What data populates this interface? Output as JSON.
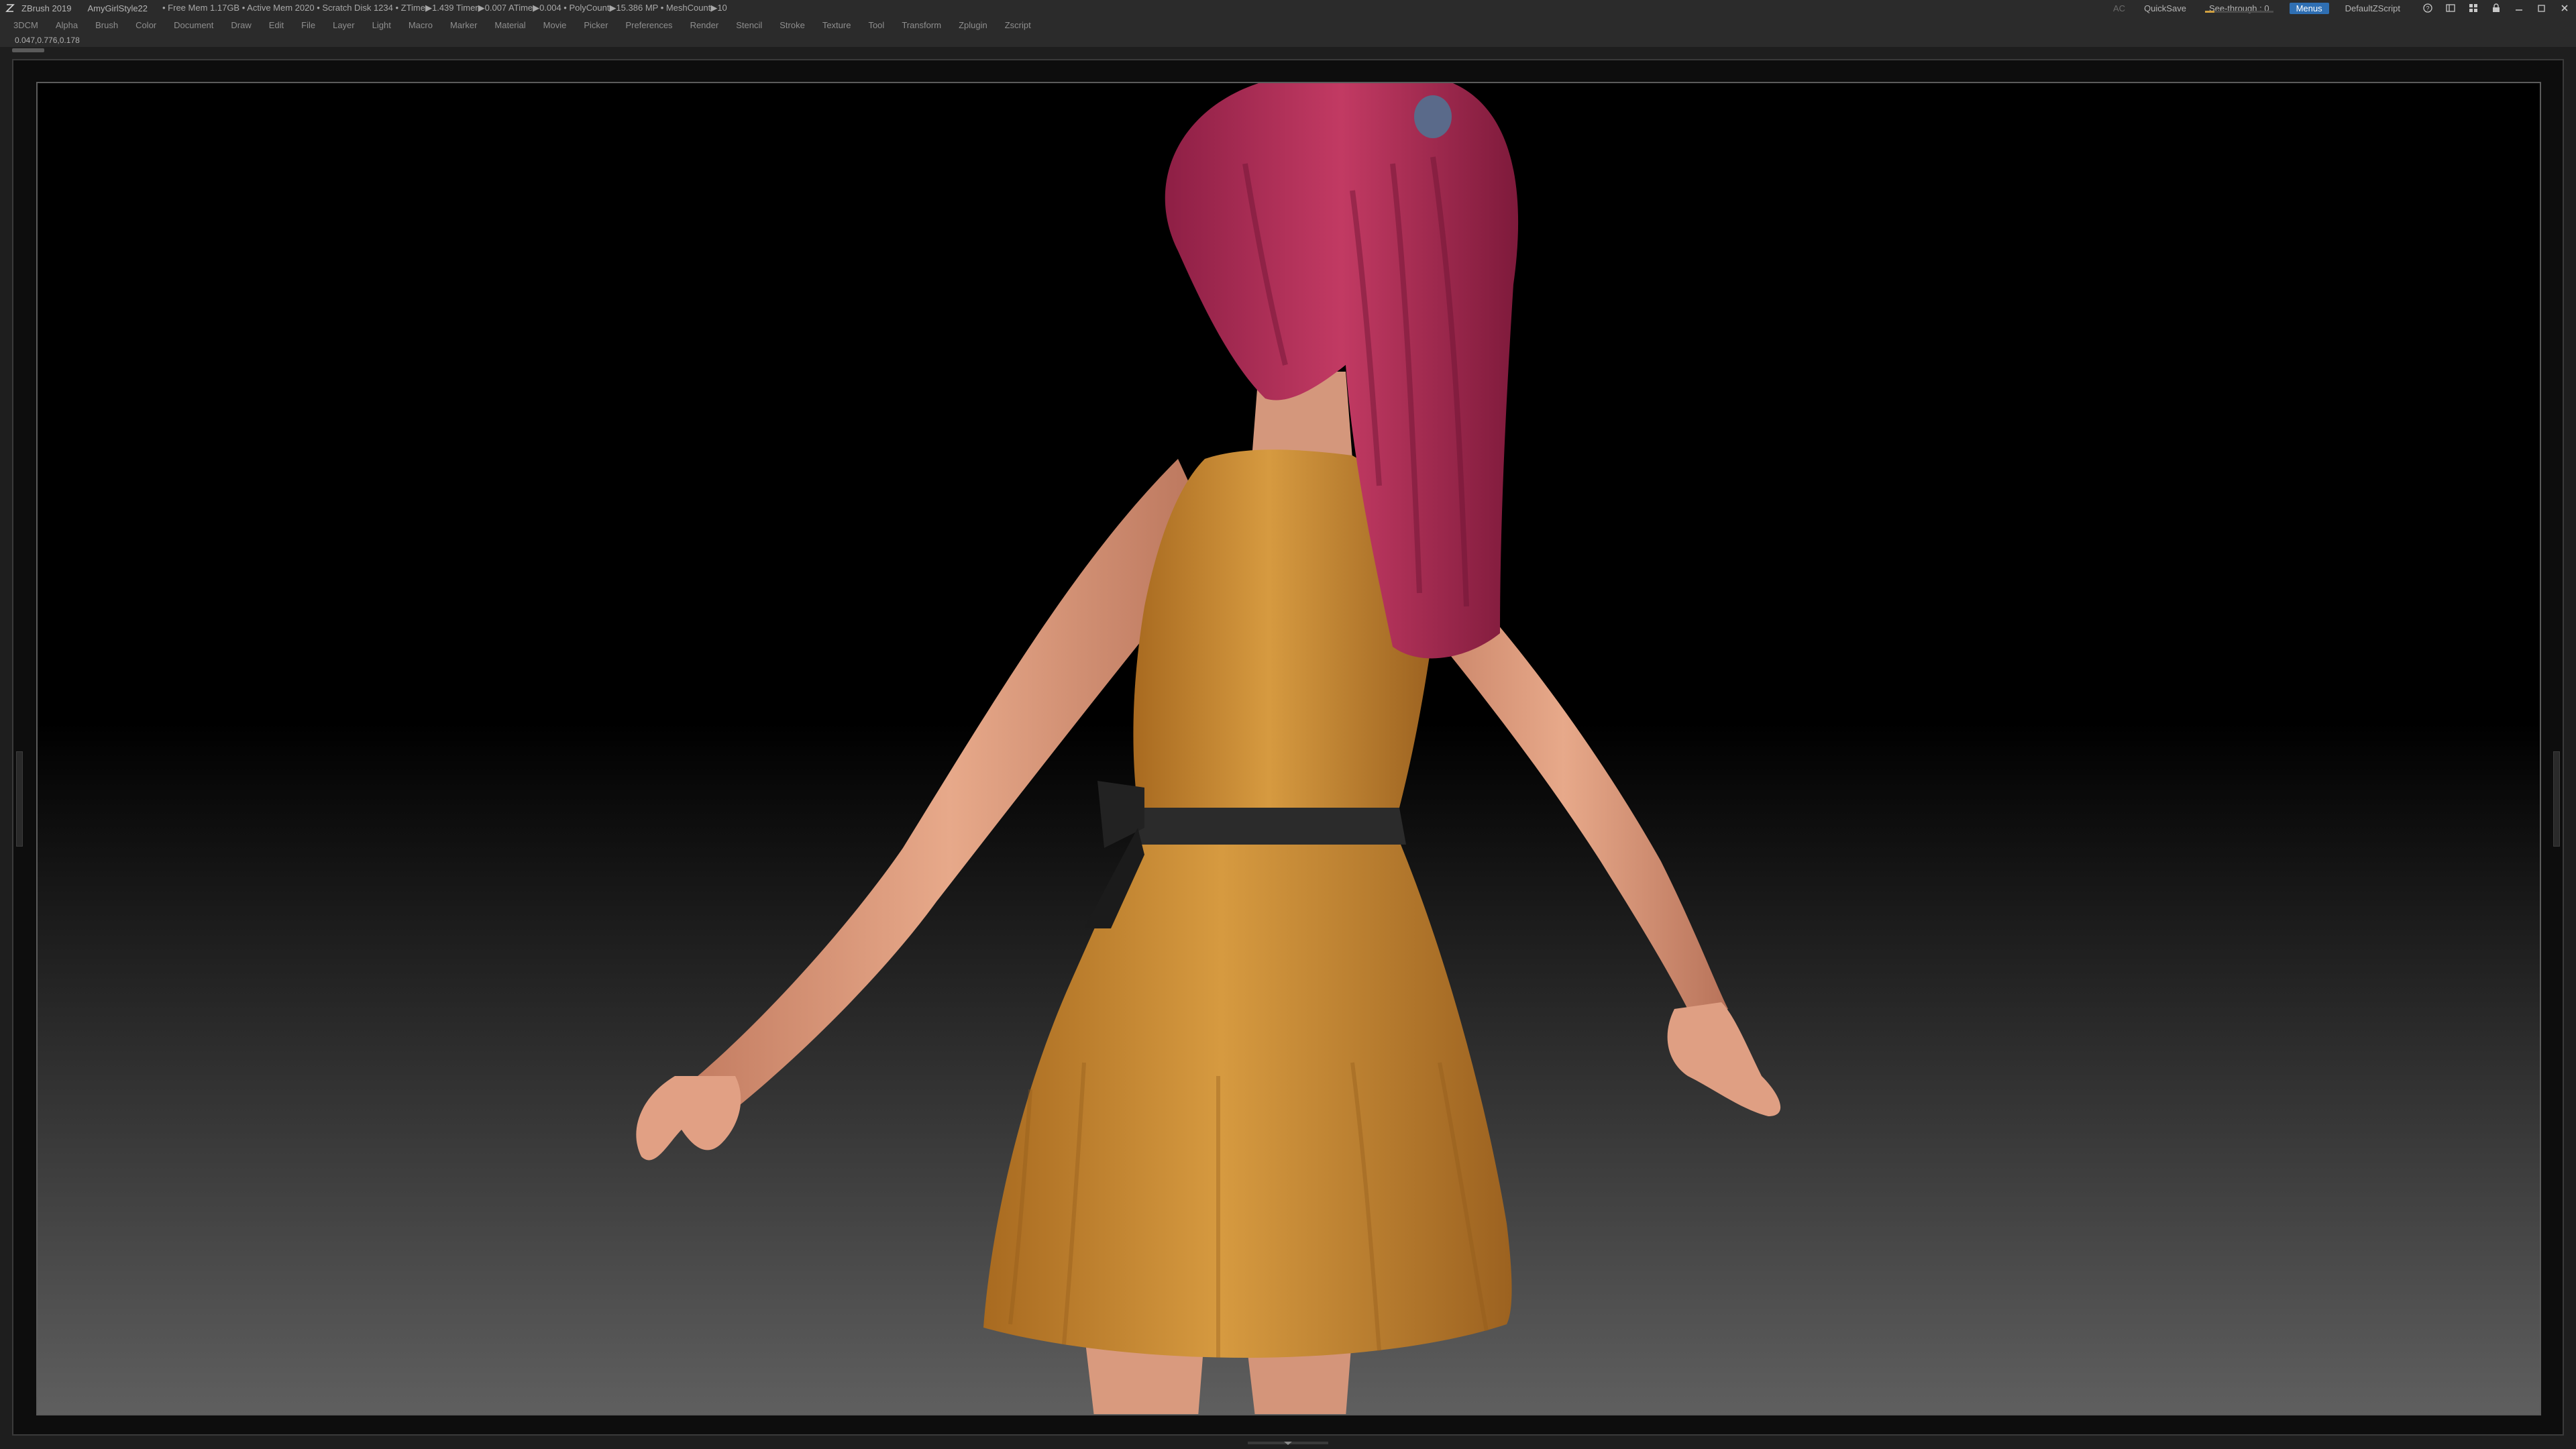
{
  "titlebar": {
    "app_name": "ZBrush 2019",
    "document_name": "AmyGirlStyle22",
    "stats": "• Free Mem 1.17GB • Active Mem 2020 • Scratch Disk 1234 • ZTime▶1.439 Timer▶0.007 ATime▶0.004 • PolyCount▶15.386 MP • MeshCount▶10",
    "ac_label": "AC",
    "quicksave_label": "QuickSave",
    "see_through_label": "See-through",
    "see_through_value": "0",
    "menus_label": "Menus",
    "default_script_label": "DefaultZScript"
  },
  "menus": [
    "3DCM",
    "Alpha",
    "Brush",
    "Color",
    "Document",
    "Draw",
    "Edit",
    "File",
    "Layer",
    "Light",
    "Macro",
    "Marker",
    "Material",
    "Movie",
    "Picker",
    "Preferences",
    "Render",
    "Stencil",
    "Stroke",
    "Texture",
    "Tool",
    "Transform",
    "Zplugin",
    "Zscript"
  ],
  "coords": "0.047,0.776,0.178",
  "colors": {
    "menus_accent": "#2f6fb3",
    "see_through_fill": "#d0a040",
    "dress": "#c98a30",
    "hair": "#b02e55",
    "skin": "#e0a080",
    "belt": "#2a2a2a"
  },
  "icons": [
    "zbrush-logo-icon",
    "help-icon",
    "layout-icon",
    "arrange-icon",
    "lock-icon",
    "minimize-icon",
    "restore-icon",
    "close-icon"
  ]
}
